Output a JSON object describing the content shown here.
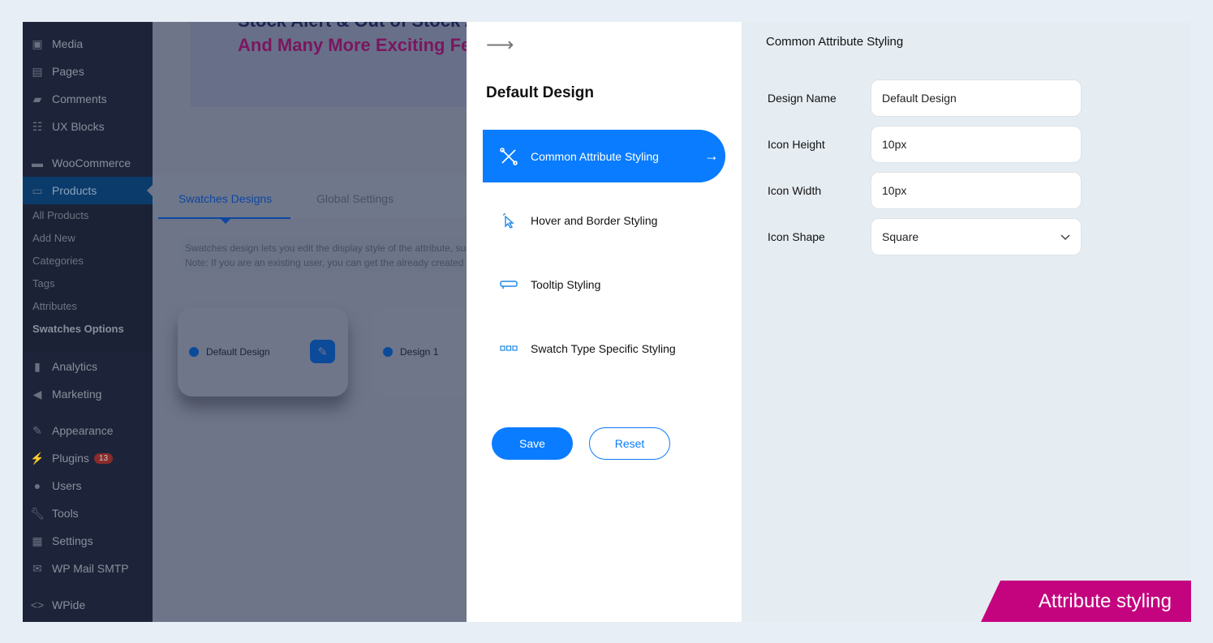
{
  "sidebar": {
    "items": [
      {
        "label": "Media",
        "icon": "media-icon"
      },
      {
        "label": "Pages",
        "icon": "pages-icon"
      },
      {
        "label": "Comments",
        "icon": "comments-icon"
      },
      {
        "label": "UX Blocks",
        "icon": "ux-blocks-icon"
      },
      {
        "label": "WooCommerce",
        "icon": "woocommerce-icon"
      },
      {
        "label": "Products",
        "icon": "products-icon"
      },
      {
        "label": "Analytics",
        "icon": "analytics-icon"
      },
      {
        "label": "Marketing",
        "icon": "marketing-icon"
      },
      {
        "label": "Appearance",
        "icon": "appearance-icon"
      },
      {
        "label": "Plugins",
        "icon": "plugins-icon",
        "badge": "13"
      },
      {
        "label": "Users",
        "icon": "users-icon"
      },
      {
        "label": "Tools",
        "icon": "tools-icon"
      },
      {
        "label": "Settings",
        "icon": "settings-icon"
      },
      {
        "label": "WP Mail SMTP",
        "icon": "mail-icon"
      },
      {
        "label": "WPide",
        "icon": "code-icon"
      }
    ],
    "submenu": [
      "All Products",
      "Add New",
      "Categories",
      "Tags",
      "Attributes",
      "Swatches Options"
    ]
  },
  "background": {
    "headline1": "Stock Alert & Out of Stock A",
    "headline2": "And Many More Exciting Fea",
    "tabs": [
      "Swatches Designs",
      "Global Settings"
    ],
    "note_line1": "Swatches design lets you edit the display style of the attribute, such",
    "note_line2": "Note: If you are an existing user, you can get the already created de",
    "cards": [
      "Default Design",
      "Design 1"
    ]
  },
  "drawer": {
    "title": "Default Design",
    "menu": [
      "Common Attribute Styling",
      "Hover and Border Styling",
      "Tooltip Styling",
      "Swatch Type Specific Styling"
    ],
    "save": "Save",
    "reset": "Reset"
  },
  "panel": {
    "title": "Common Attribute Styling",
    "fields": [
      {
        "label": "Design Name",
        "value": "Default Design"
      },
      {
        "label": "Icon Height",
        "value": "10px"
      },
      {
        "label": "Icon Width",
        "value": "10px"
      },
      {
        "label": "Icon Shape",
        "value": "Square"
      }
    ]
  },
  "caption": "Attribute styling",
  "colors": {
    "accent": "#0a7cff",
    "caption_bg": "#c4047f"
  }
}
